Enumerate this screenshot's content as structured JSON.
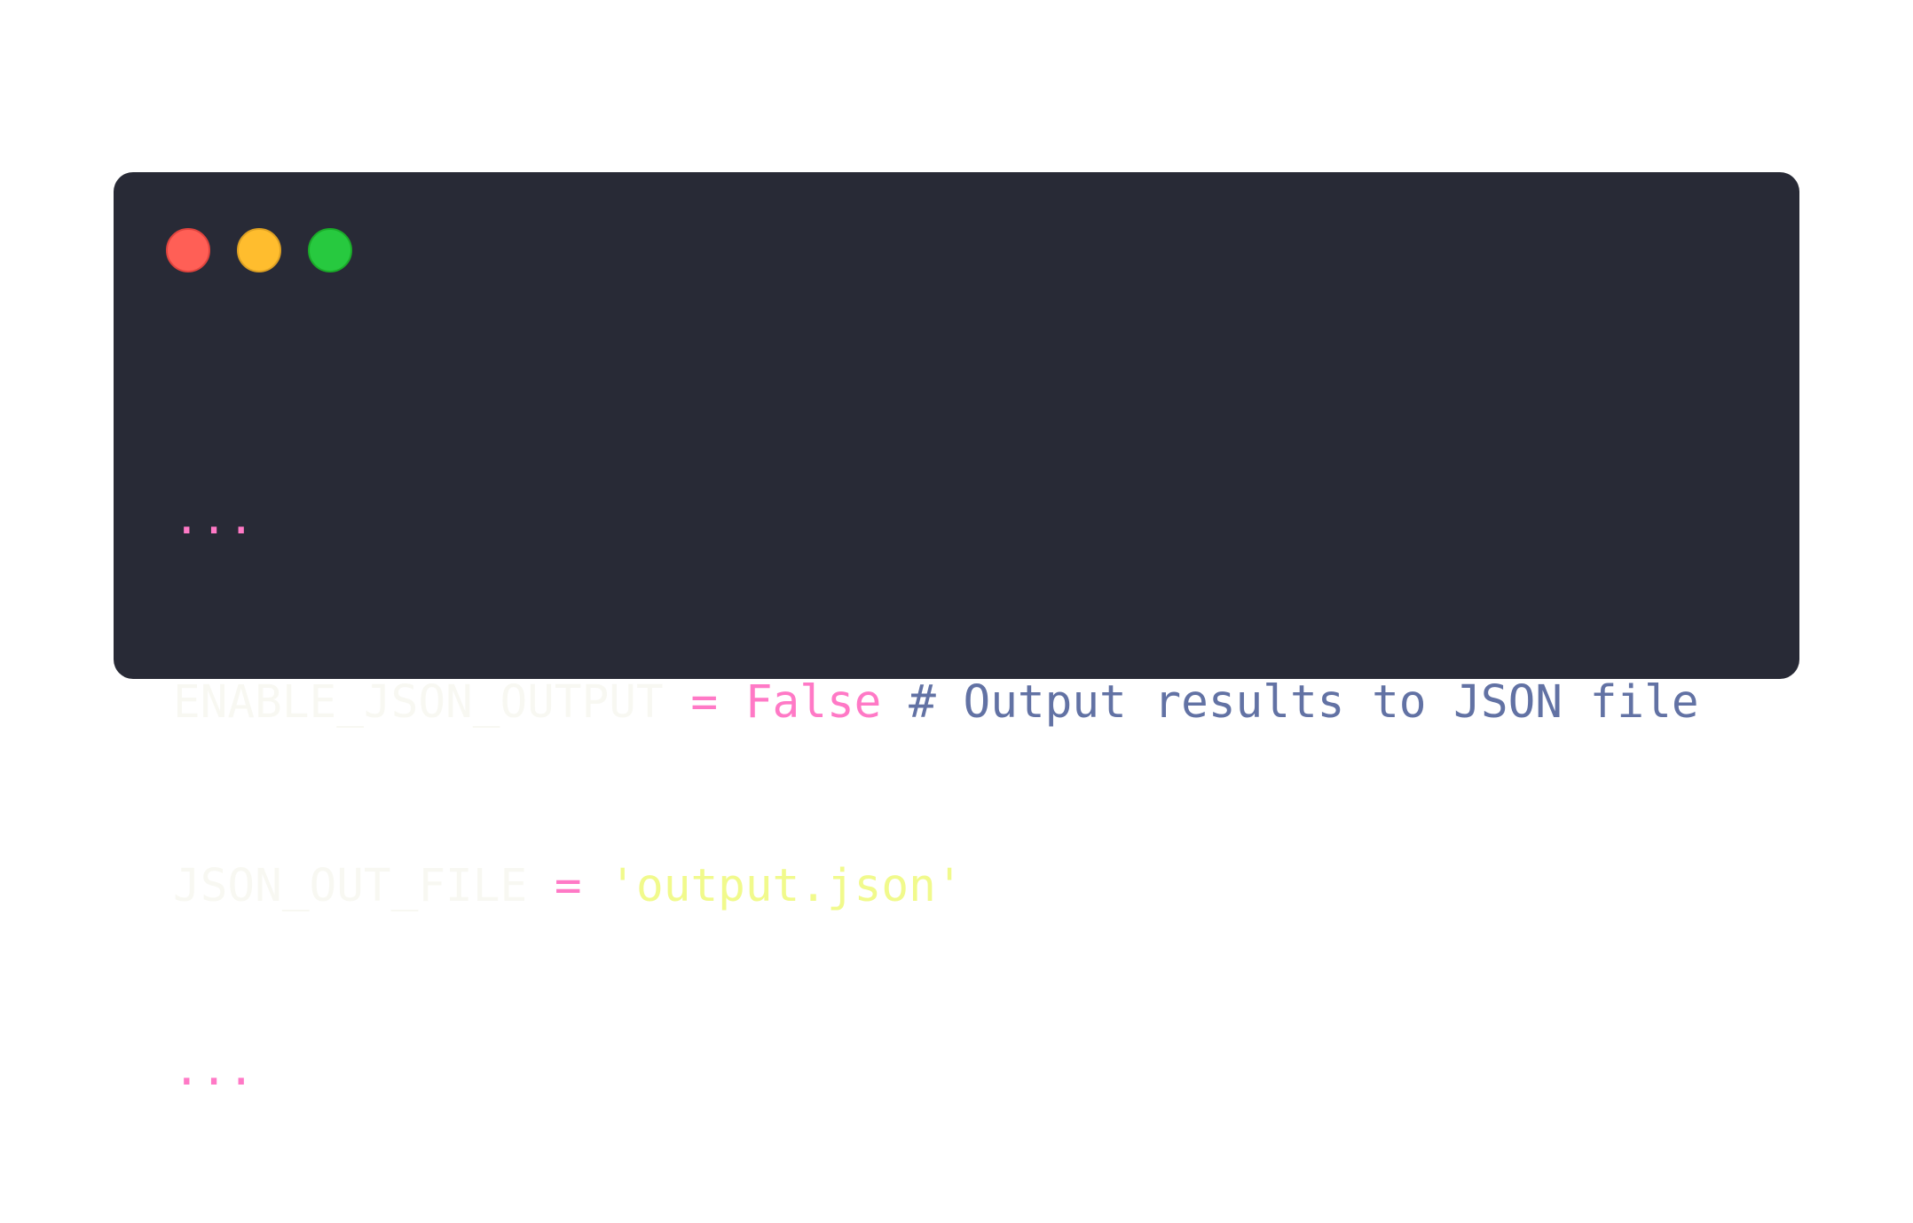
{
  "window": {
    "controls": {
      "close": "close-dot",
      "minimize": "minimize-dot",
      "maximize": "maximize-dot"
    }
  },
  "code": {
    "line1": {
      "ellipsis": "..."
    },
    "line2": {
      "identifier": "ENABLE_JSON_OUTPUT",
      "operator": "=",
      "value": "False",
      "comment": "# Output results to JSON file"
    },
    "line3": {
      "identifier": "JSON_OUT_FILE",
      "operator": "=",
      "value": "'output.json'"
    },
    "line4": {
      "ellipsis": "..."
    }
  },
  "colors": {
    "background": "#282a36",
    "text": "#f8f8f2",
    "keyword": "#ff79c6",
    "comment": "#6272a4",
    "string": "#f1fa8c"
  }
}
